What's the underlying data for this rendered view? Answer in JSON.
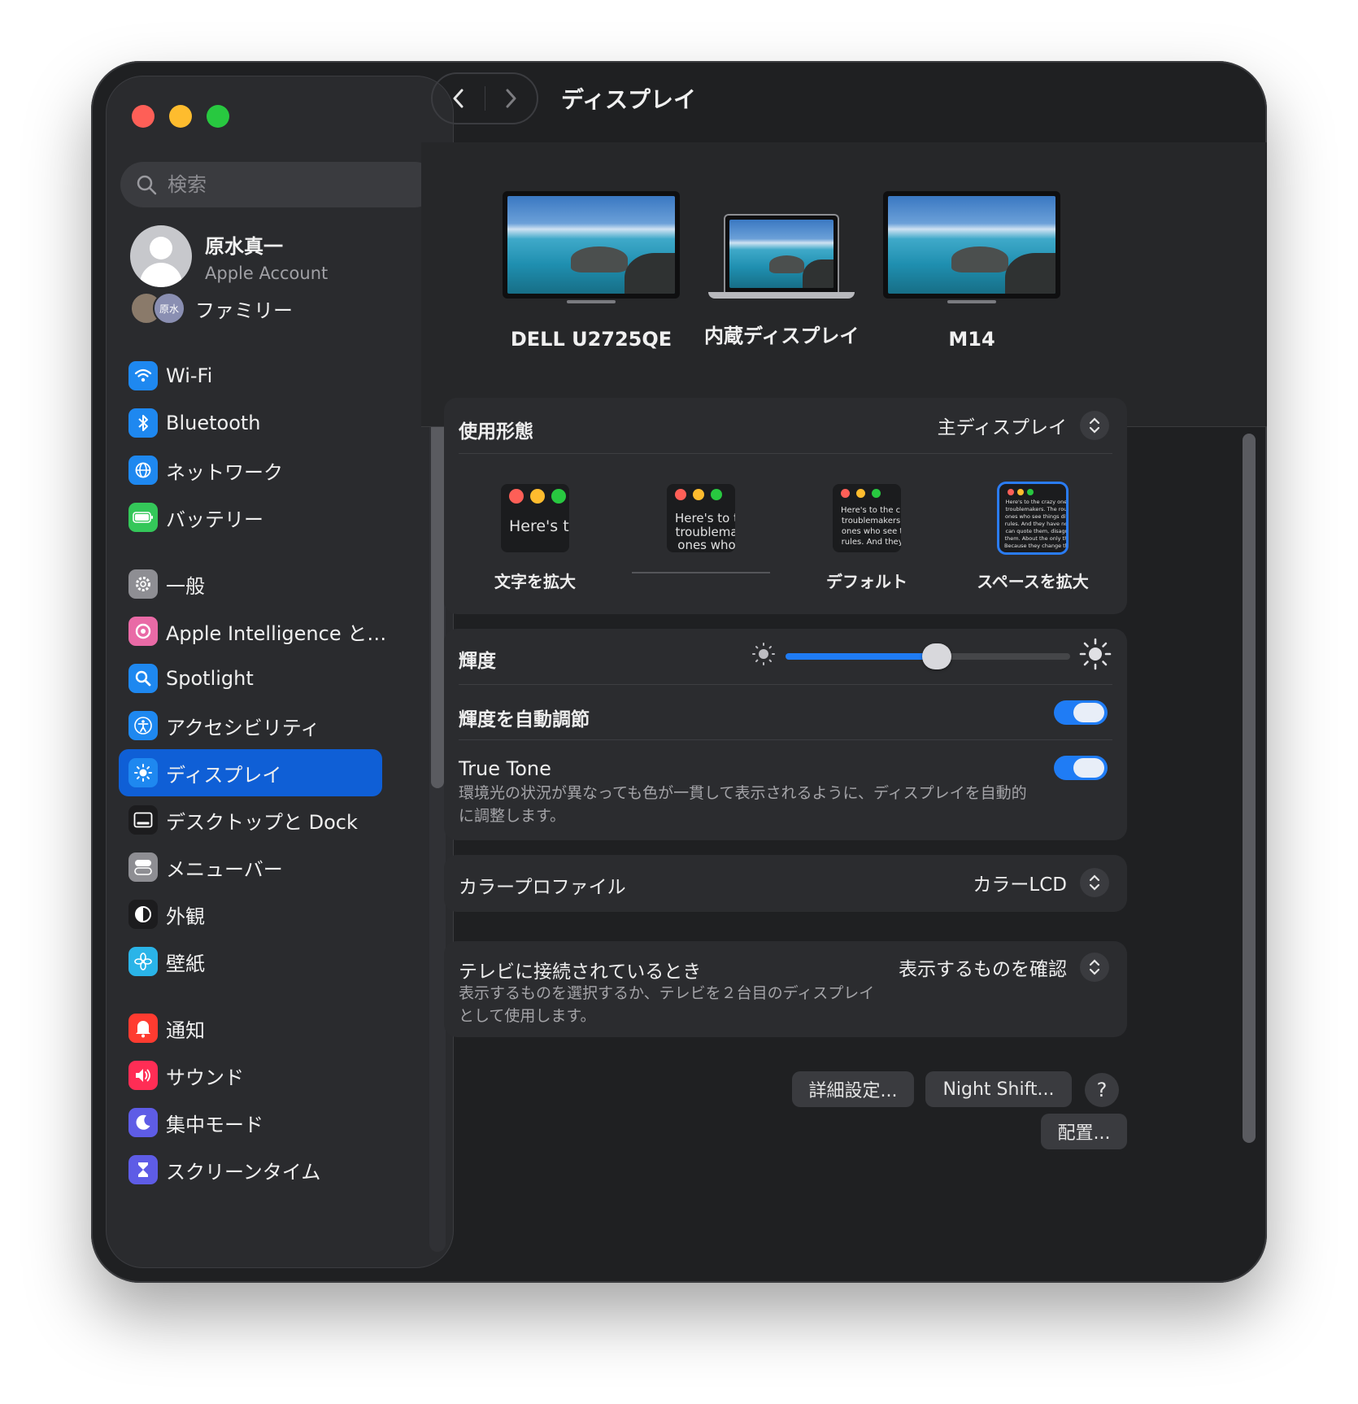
{
  "window": {
    "traffic_lights": [
      "close",
      "minimize",
      "zoom"
    ]
  },
  "sidebar": {
    "search_placeholder": "検索",
    "account": {
      "name": "原水真一",
      "subtitle": "Apple Account"
    },
    "family": {
      "label": "ファミリー",
      "avatar_text": "原水"
    },
    "items": [
      {
        "label": "Wi-Fi",
        "icon": "wifi-icon",
        "color": "#1e88f0"
      },
      {
        "label": "Bluetooth",
        "icon": "bluetooth-icon",
        "color": "#1e88f0"
      },
      {
        "label": "ネットワーク",
        "icon": "globe-icon",
        "color": "#1e88f0"
      },
      {
        "label": "バッテリー",
        "icon": "battery-icon",
        "color": "#34c759"
      },
      {
        "label": "一般",
        "icon": "gear-icon",
        "color": "#8e8e93"
      },
      {
        "label": "Apple Intelligence と…",
        "icon": "apple-intelligence-icon",
        "color": "#e96aa6"
      },
      {
        "label": "Spotlight",
        "icon": "magnifier-icon",
        "color": "#1e88f0"
      },
      {
        "label": "アクセシビリティ",
        "icon": "accessibility-icon",
        "color": "#1e88f0"
      },
      {
        "label": "ディスプレイ",
        "icon": "sun-icon",
        "color": "#1e88f0",
        "active": true
      },
      {
        "label": "デスクトップと Dock",
        "icon": "dock-icon",
        "color": "#1c1c1e"
      },
      {
        "label": "メニューバー",
        "icon": "menubar-icon",
        "color": "#8e8e93"
      },
      {
        "label": "外観",
        "icon": "appearance-icon",
        "color": "#1c1c1e"
      },
      {
        "label": "壁紙",
        "icon": "flower-icon",
        "color": "#2ab4e8"
      },
      {
        "label": "通知",
        "icon": "bell-icon",
        "color": "#ff3b30"
      },
      {
        "label": "サウンド",
        "icon": "speaker-icon",
        "color": "#ff2d55"
      },
      {
        "label": "集中モード",
        "icon": "moon-icon",
        "color": "#5e5ce6"
      },
      {
        "label": "スクリーンタイム",
        "icon": "hourglass-icon",
        "color": "#5e5ce6"
      }
    ]
  },
  "toolbar": {
    "title": "ディスプレイ"
  },
  "displays": [
    {
      "label": "DELL U2725QE",
      "type": "monitor"
    },
    {
      "label": "内蔵ディスプレイ",
      "type": "laptop",
      "selected": true
    },
    {
      "label": "M14",
      "type": "monitor"
    }
  ],
  "usage": {
    "label": "使用形態",
    "value": "主ディスプレイ",
    "options": [
      {
        "label": "文字を拡大",
        "sample": "Here's to\ntroublem"
      },
      {
        "label": "",
        "sample": "Here's to t\ntroublema\nones who"
      },
      {
        "label": "デフォルト",
        "sample": "Here's to the cr\ntroublemakers.\nones who see t\nrules. And they"
      },
      {
        "label": "スペースを拡大",
        "sample": "Here's to the crazy one\ntroublemakers. The rou\nones who see things dif\nrules. And they have no\ncan quote them, disagr\nthem. About the only th\nBecause they change th",
        "selected": true
      }
    ]
  },
  "brightness": {
    "label": "輝度",
    "value": 0.53
  },
  "auto_brightness": {
    "label": "輝度を自動調節",
    "on": true
  },
  "true_tone": {
    "label": "True Tone",
    "description": "環境光の状況が異なっても色が一貫して表示されるように、ディスプレイを自動的に調整します。",
    "on": true
  },
  "color_profile": {
    "label": "カラープロファイル",
    "value": "カラーLCD"
  },
  "tv": {
    "label": "テレビに接続されているとき",
    "description": "表示するものを選択するか、テレビを２台目のディスプレイとして使用します。",
    "value": "表示するものを確認"
  },
  "buttons": {
    "advanced": "詳細設定...",
    "night_shift": "Night Shift...",
    "help": "?",
    "arrange": "配置..."
  }
}
